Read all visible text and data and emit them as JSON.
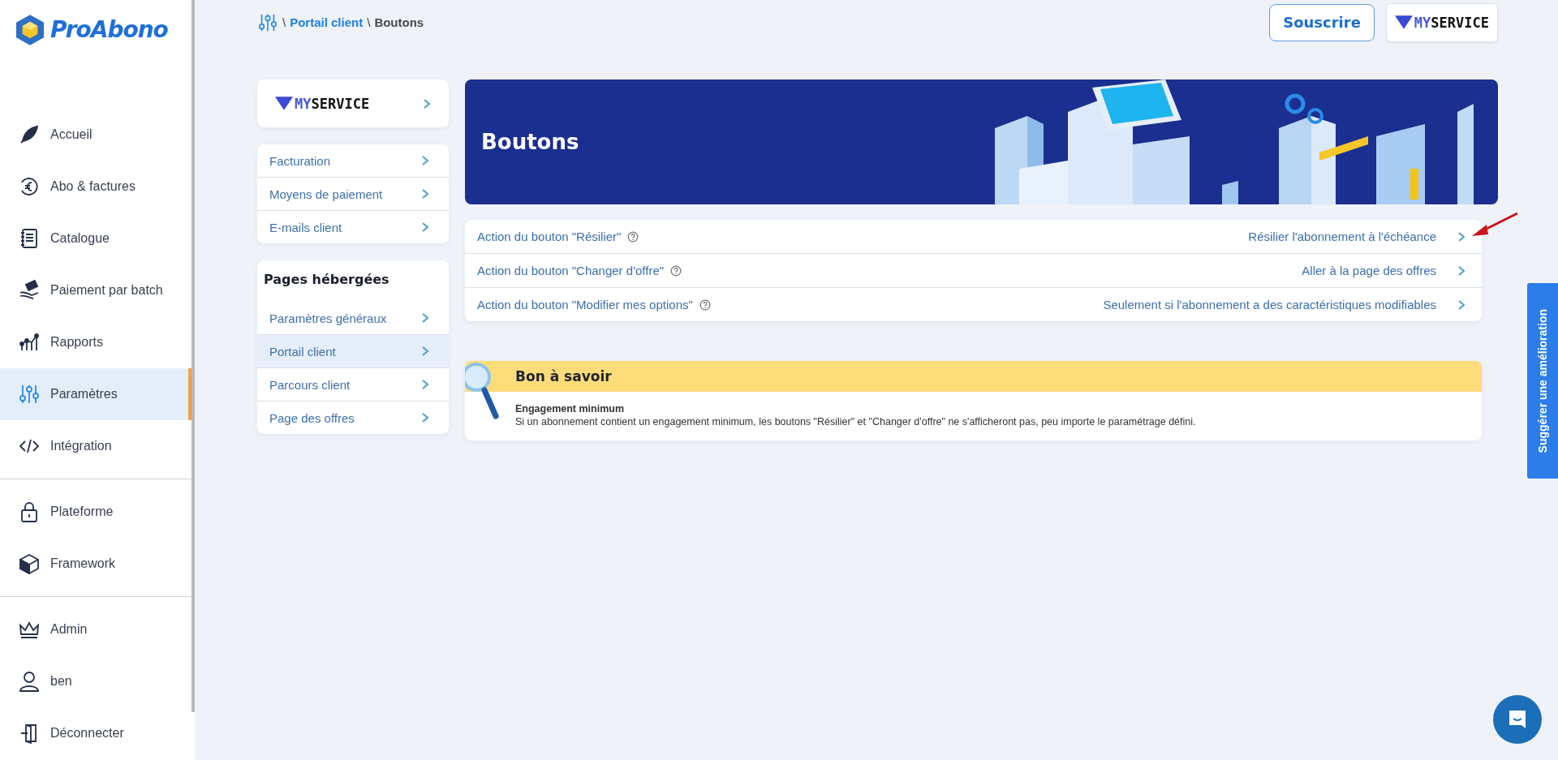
{
  "brand": {
    "name": "ProAbono"
  },
  "nav_groups": [
    [
      {
        "label": "Accueil",
        "selected": false
      },
      {
        "label": "Abo & factures",
        "selected": false
      },
      {
        "label": "Catalogue",
        "selected": false
      },
      {
        "label": "Paiement par batch",
        "selected": false
      },
      {
        "label": "Rapports",
        "selected": false
      },
      {
        "label": "Paramètres",
        "selected": true
      },
      {
        "label": "Intégration",
        "selected": false
      }
    ],
    [
      {
        "label": "Plateforme",
        "selected": false
      },
      {
        "label": "Framework",
        "selected": false
      }
    ],
    [
      {
        "label": "Admin",
        "selected": false
      },
      {
        "label": "ben",
        "selected": false
      },
      {
        "label": "Déconnecter",
        "selected": false
      }
    ]
  ],
  "breadcrumb": {
    "separator": "\\",
    "items": [
      {
        "label": "Portail client",
        "kind": "link"
      },
      {
        "label": "Boutons",
        "kind": "current"
      }
    ]
  },
  "header": {
    "subscribe": "Souscrire",
    "service_logo": {
      "prefix": "MY",
      "name": "SERVICE"
    }
  },
  "settings_menu": {
    "service_logo": {
      "prefix": "MY",
      "name": "SERVICE"
    },
    "groups": [
      {
        "items": [
          {
            "label": "Facturation",
            "selected": false
          },
          {
            "label": "Moyens de paiement",
            "selected": false
          },
          {
            "label": "E-mails client",
            "selected": false
          }
        ]
      },
      {
        "title": "Pages hébergées",
        "items": [
          {
            "label": "Paramètres généraux",
            "selected": false
          },
          {
            "label": "Portail client",
            "selected": true
          },
          {
            "label": "Parcours client",
            "selected": false
          },
          {
            "label": "Page des offres",
            "selected": false
          }
        ]
      }
    ]
  },
  "banner": {
    "title": "Boutons"
  },
  "actions": [
    {
      "label": "Action du bouton \"Résilier\"",
      "value": "Résilier l'abonnement à l'échéance"
    },
    {
      "label": "Action du bouton \"Changer d'offre\"",
      "value": "Aller à la page des offres"
    },
    {
      "label": "Action du bouton \"Modifier mes options\"",
      "value": "Seulement si l'abonnement a des caractéristiques modifiables"
    }
  ],
  "notice": {
    "title": "Bon à savoir",
    "heading": "Engagement minimum",
    "text": "Si un abonnement contient un engagement minimum, les boutons \"Résilier\" et \"Changer d'offre\" ne s'afficheront pas, peu importe le paramétrage défini."
  },
  "feedback_tab": {
    "label": "Suggérer une amélioration"
  }
}
